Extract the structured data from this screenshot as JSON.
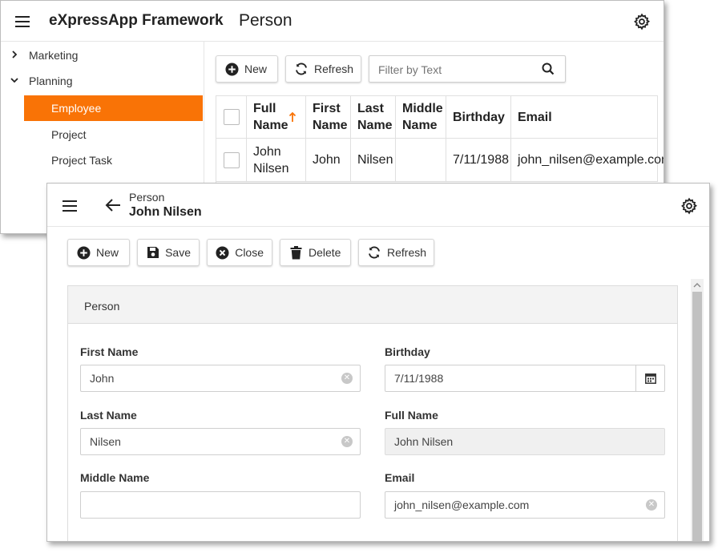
{
  "back": {
    "app_title": "eXpressApp Framework",
    "view_title": "Person",
    "nav": [
      {
        "label": "Marketing",
        "expanded": false
      },
      {
        "label": "Planning",
        "expanded": true
      }
    ],
    "nav_children": [
      "Employee",
      "Project",
      "Project Task"
    ],
    "selected_child": "Employee",
    "toolbar": {
      "new_label": "New",
      "refresh_label": "Refresh"
    },
    "search": {
      "placeholder": "Filter by Text"
    },
    "grid": {
      "columns": [
        "Full Name",
        "First Name",
        "Last Name",
        "Middle Name",
        "Birthday",
        "Email"
      ],
      "sorted_column": "Full Name",
      "rows": [
        {
          "full_name": "John Nilsen",
          "first_name": "John",
          "last_name": "Nilsen",
          "middle_name": "",
          "birthday": "7/11/1988",
          "email": "john_nilsen@example.com"
        }
      ]
    }
  },
  "front": {
    "breadcrumb": "Person",
    "title": "John Nilsen",
    "toolbar": {
      "new": "New",
      "save": "Save",
      "close": "Close",
      "delete": "Delete",
      "refresh": "Refresh"
    },
    "group_title": "Person",
    "fields": {
      "first_name": {
        "label": "First Name",
        "value": "John"
      },
      "last_name": {
        "label": "Last Name",
        "value": "Nilsen"
      },
      "middle_name": {
        "label": "Middle Name",
        "value": ""
      },
      "birthday": {
        "label": "Birthday",
        "value": "7/11/1988"
      },
      "full_name": {
        "label": "Full Name",
        "value": "John Nilsen"
      },
      "email": {
        "label": "Email",
        "value": "john_nilsen@example.com"
      }
    }
  },
  "colors": {
    "accent": "#f97306",
    "text": "#222222",
    "border": "#d6d6d6"
  },
  "icons": [
    "menu-icon",
    "gear-icon",
    "chevron-right-icon",
    "chevron-down-icon",
    "plus-circle-icon",
    "refresh-icon",
    "search-icon",
    "sort-up-icon",
    "back-arrow-icon",
    "save-icon",
    "close-circle-icon",
    "trash-icon",
    "calendar-icon",
    "clear-icon"
  ]
}
